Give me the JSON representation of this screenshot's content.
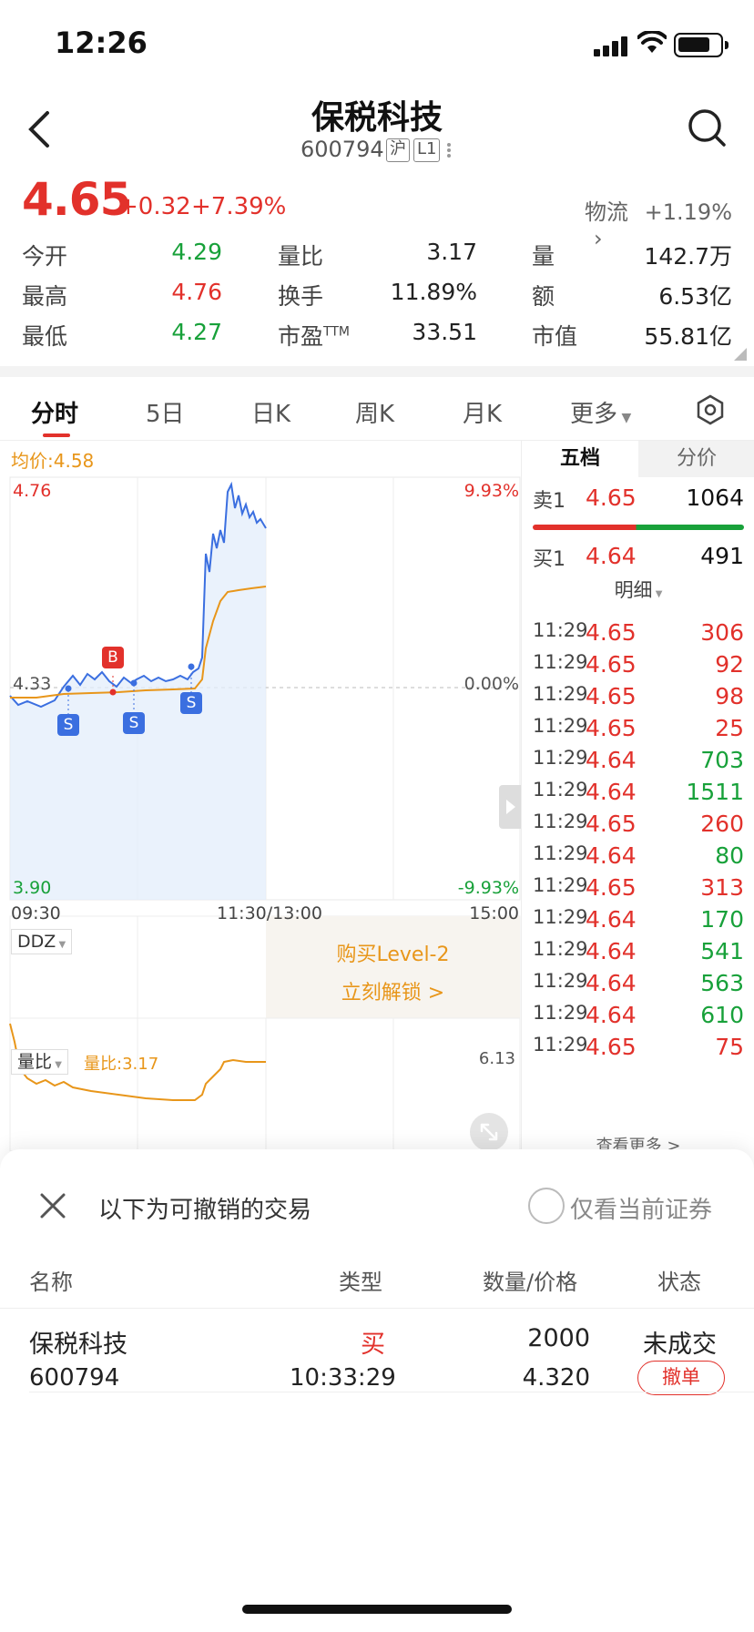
{
  "status_bar": {
    "time": "12:26"
  },
  "header": {
    "title": "保税科技",
    "code": "600794",
    "market_tag": "沪",
    "level_tag": "L1"
  },
  "quote": {
    "price": "4.65",
    "change": "+0.32",
    "change_pct": "+7.39%",
    "sector_name": "物流",
    "sector_change": "+1.19%",
    "stats": [
      [
        {
          "label": "今开",
          "value": "4.29",
          "color": "green"
        },
        {
          "label": "量比",
          "value": "3.17",
          "color": "dark"
        },
        {
          "label": "量",
          "value": "142.7万",
          "color": "dark"
        }
      ],
      [
        {
          "label": "最高",
          "value": "4.76",
          "color": "red"
        },
        {
          "label": "换手",
          "value": "11.89%",
          "color": "dark"
        },
        {
          "label": "额",
          "value": "6.53亿",
          "color": "dark"
        }
      ],
      [
        {
          "label": "最低",
          "value": "4.27",
          "color": "green"
        },
        {
          "label": "市盈TTM",
          "value": "33.51",
          "color": "dark"
        },
        {
          "label": "市值",
          "value": "55.81亿",
          "color": "dark"
        }
      ]
    ]
  },
  "tabs": [
    "分时",
    "5日",
    "日K",
    "周K",
    "月K",
    "更多"
  ],
  "chart": {
    "avg_label": "均价:4.58",
    "y_top": "4.76",
    "y_mid": "4.33",
    "y_bot": "3.90",
    "pct_top": "9.93%",
    "pct_mid": "0.00%",
    "pct_bot": "-9.93%",
    "time_start": "09:30",
    "time_mid": "11:30/13:00",
    "time_end": "15:00",
    "markers": [
      "S",
      "B",
      "S",
      "S"
    ],
    "indicator": "DDZ",
    "level2_line1": "购买Level-2",
    "level2_line2": "立刻解锁 >",
    "volratio_label": "量比",
    "volratio_value": "量比:3.17",
    "volratio_max": "6.13",
    "colors": {
      "price_line": "#3b6fe0",
      "avg_line": "#e8961a",
      "up": "#e2312b",
      "down": "#18a13a"
    }
  },
  "chart_data": {
    "type": "line",
    "x": [
      "09:30",
      "09:40",
      "09:50",
      "10:00",
      "10:10",
      "10:20",
      "10:30",
      "10:40",
      "10:50",
      "11:00",
      "11:10",
      "11:20",
      "11:29"
    ],
    "series": [],
    "ylim": [
      3.9,
      4.76
    ],
    "title": "",
    "xlabel": "",
    "ylabel": ""
  },
  "orderbook": {
    "tabs": [
      "五档",
      "分价"
    ],
    "sell1": {
      "label": "卖1",
      "price": "4.65",
      "vol": "1064"
    },
    "buy1": {
      "label": "买1",
      "price": "4.64",
      "vol": "491"
    },
    "detail_label": "明细",
    "ticks": [
      {
        "time": "11:29",
        "price": "4.65",
        "vol": "306",
        "dir": "up"
      },
      {
        "time": "11:29",
        "price": "4.65",
        "vol": "92",
        "dir": "up"
      },
      {
        "time": "11:29",
        "price": "4.65",
        "vol": "98",
        "dir": "up"
      },
      {
        "time": "11:29",
        "price": "4.65",
        "vol": "25",
        "dir": "up"
      },
      {
        "time": "11:29",
        "price": "4.64",
        "vol": "703",
        "dir": "down"
      },
      {
        "time": "11:29",
        "price": "4.64",
        "vol": "1511",
        "dir": "down"
      },
      {
        "time": "11:29",
        "price": "4.65",
        "vol": "260",
        "dir": "up"
      },
      {
        "time": "11:29",
        "price": "4.64",
        "vol": "80",
        "dir": "down"
      },
      {
        "time": "11:29",
        "price": "4.65",
        "vol": "313",
        "dir": "up"
      },
      {
        "time": "11:29",
        "price": "4.64",
        "vol": "170",
        "dir": "down"
      },
      {
        "time": "11:29",
        "price": "4.64",
        "vol": "541",
        "dir": "down"
      },
      {
        "time": "11:29",
        "price": "4.64",
        "vol": "563",
        "dir": "down"
      },
      {
        "time": "11:29",
        "price": "4.64",
        "vol": "610",
        "dir": "down"
      },
      {
        "time": "11:29",
        "price": "4.65",
        "vol": "75",
        "dir": "up"
      }
    ],
    "more_label": "查看更多 >"
  },
  "cancel_panel": {
    "title": "以下为可撤销的交易",
    "filter_label": "仅看当前证券",
    "headers": {
      "name": "名称",
      "type": "类型",
      "qty_price": "数量/价格",
      "status": "状态"
    },
    "order": {
      "name": "保税科技",
      "code": "600794",
      "type": "买",
      "time": "10:33:29",
      "qty": "2000",
      "price": "4.320",
      "status": "未成交",
      "cancel_button": "撤单"
    }
  }
}
